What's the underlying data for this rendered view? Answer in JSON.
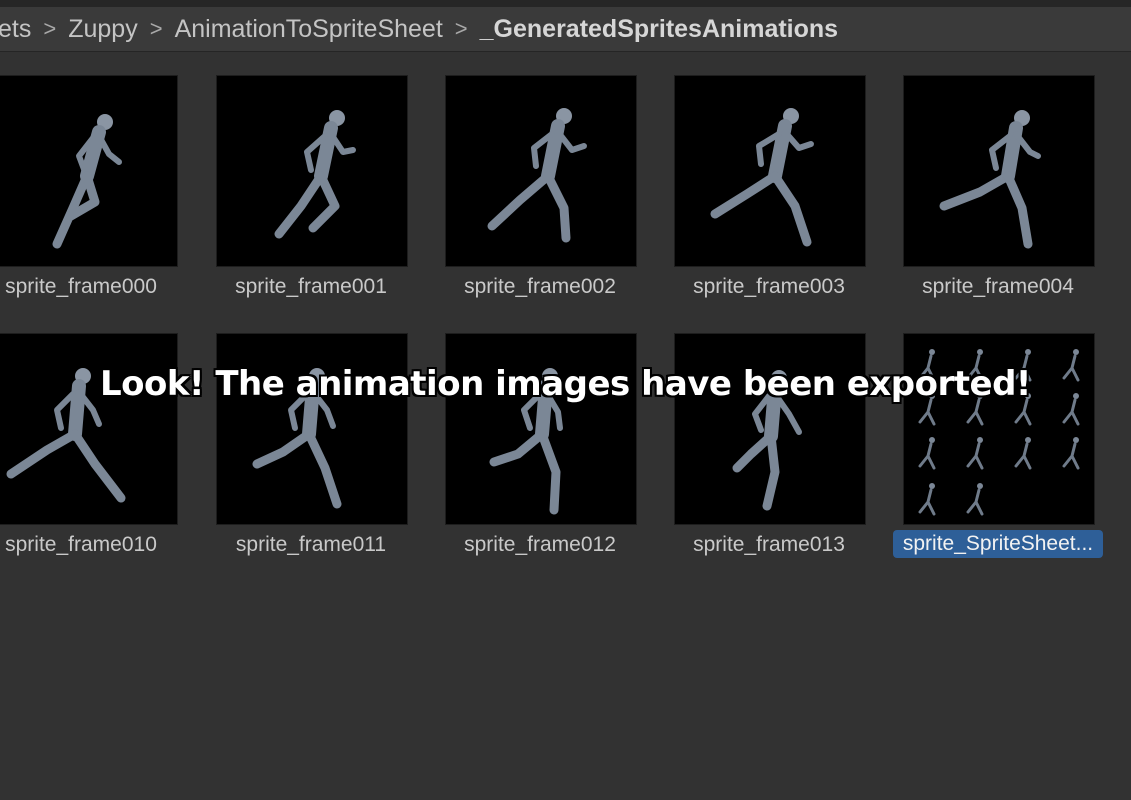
{
  "breadcrumb": {
    "items": [
      "ets",
      "Zuppy",
      "AnimationToSpriteSheet",
      "_GeneratedSpritesAnimations"
    ],
    "separator": ">"
  },
  "assets": [
    {
      "name": "sprite_frame000",
      "selected": false
    },
    {
      "name": "sprite_frame001",
      "selected": false
    },
    {
      "name": "sprite_frame002",
      "selected": false
    },
    {
      "name": "sprite_frame003",
      "selected": false
    },
    {
      "name": "sprite_frame004",
      "selected": false
    },
    {
      "name": "sprite_frame010",
      "selected": false
    },
    {
      "name": "sprite_frame011",
      "selected": false
    },
    {
      "name": "sprite_frame012",
      "selected": false
    },
    {
      "name": "sprite_frame013",
      "selected": false
    },
    {
      "name": "sprite_SpriteSheet...",
      "selected": true
    }
  ],
  "overlay_caption": "Look! The animation images have been exported!",
  "colors": {
    "background": "#323232",
    "breadcrumb_bar": "#3a3a3a",
    "selection": "#2e5f98",
    "thumbnail_bg": "#000000",
    "figure": "#7b8796"
  }
}
